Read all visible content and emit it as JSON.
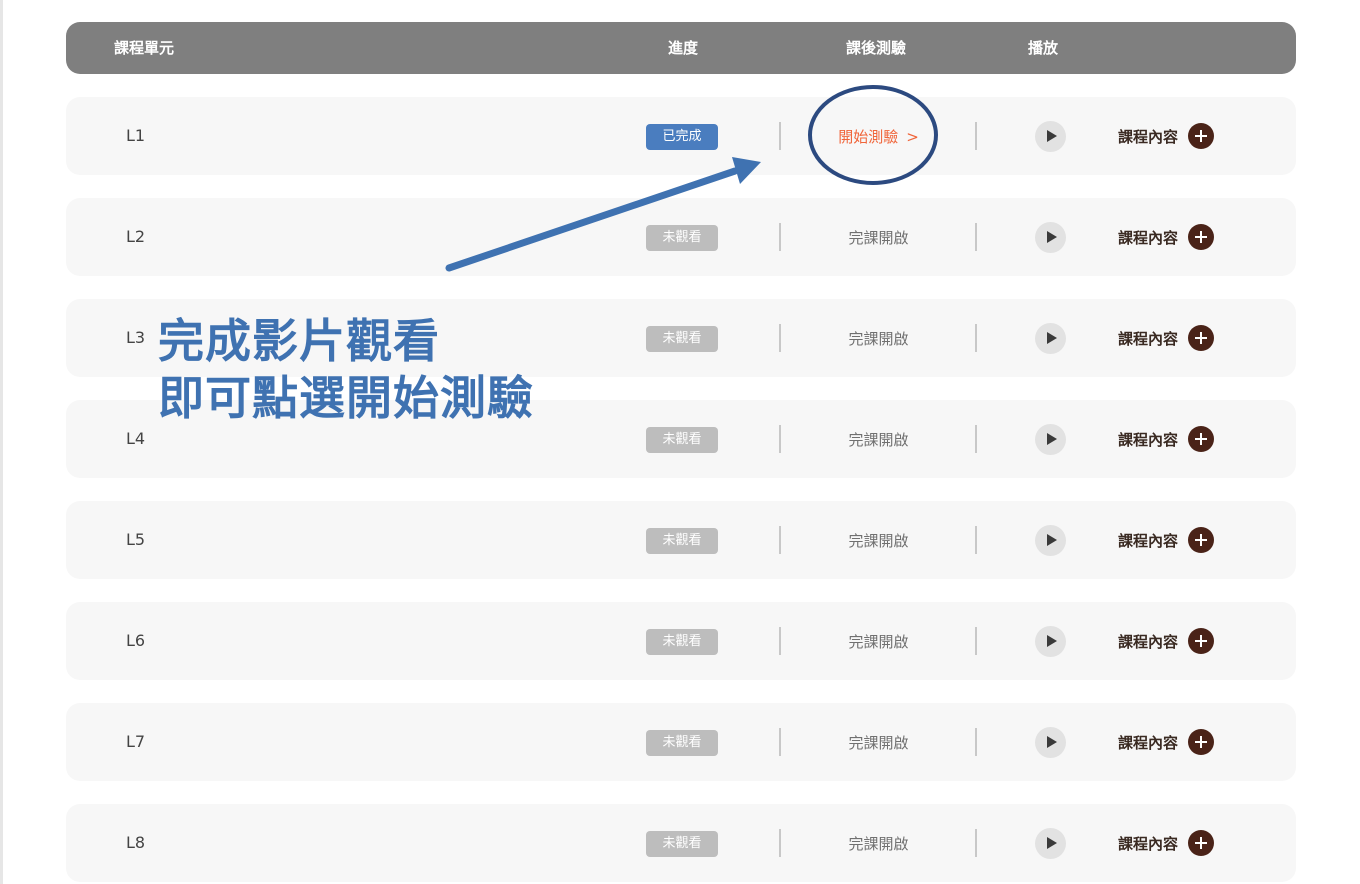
{
  "header": {
    "unit_label": "課程單元",
    "progress_label": "進度",
    "quiz_label": "課後測驗",
    "play_label": "播放"
  },
  "rows": [
    {
      "unit": "L1",
      "status": "已完成",
      "quiz": "開始測驗",
      "quiz_chevron": ">",
      "content_label": "課程內容"
    },
    {
      "unit": "L2",
      "status": "未觀看",
      "quiz": "完課開啟",
      "content_label": "課程內容"
    },
    {
      "unit": "L3",
      "status": "未觀看",
      "quiz": "完課開啟",
      "content_label": "課程內容"
    },
    {
      "unit": "L4",
      "status": "未觀看",
      "quiz": "完課開啟",
      "content_label": "課程內容"
    },
    {
      "unit": "L5",
      "status": "未觀看",
      "quiz": "完課開啟",
      "content_label": "課程內容"
    },
    {
      "unit": "L6",
      "status": "未觀看",
      "quiz": "完課開啟",
      "content_label": "課程內容"
    },
    {
      "unit": "L7",
      "status": "未觀看",
      "quiz": "完課開啟",
      "content_label": "課程內容"
    },
    {
      "unit": "L8",
      "status": "未觀看",
      "quiz": "完課開啟",
      "content_label": "課程內容"
    }
  ],
  "annotation": {
    "line1": "完成影片觀看",
    "line2": "即可點選開始測驗"
  },
  "icons": {
    "play": "play-icon",
    "plus": "plus-circle-icon",
    "chevron": "chevron-right-icon"
  },
  "colors": {
    "header_bg": "#7f7f7f",
    "done_badge": "#4a7dbf",
    "pending_badge": "#bdbdbd",
    "quiz_active": "#f0653a",
    "plus_button": "#4a2318",
    "annotation": "#3f72b1",
    "highlight_circle": "#2c4a80"
  }
}
